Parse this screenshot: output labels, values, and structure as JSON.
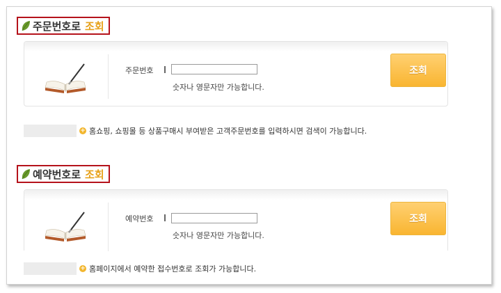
{
  "sections": [
    {
      "title": "주문번호로",
      "title_accent": "조회",
      "field_label": "주문번호",
      "input_value": "",
      "hint": "숫자나 영문자만 가능합니다.",
      "button_label": "조회",
      "note": "홈쇼핑, 쇼핑몰 등 상품구매시 부여받은 고객주문번호를 입력하시면 검색이 가능합니다."
    },
    {
      "title": "예약번호로",
      "title_accent": "조회",
      "field_label": "예약번호",
      "input_value": "",
      "hint": "숫자나 영문자만 가능합니다.",
      "button_label": "조회",
      "note": "홈페이지에서 예약한 접수번호로 조회가 가능합니다."
    }
  ],
  "icons": {
    "title": "leaf-icon",
    "panel": "open-book-pen-icon",
    "note": "plus-circle-icon"
  },
  "colors": {
    "title_border": "#b5121b",
    "accent": "#e7a21c",
    "button": "#f9b531",
    "leaf": "#6a9a2c"
  }
}
